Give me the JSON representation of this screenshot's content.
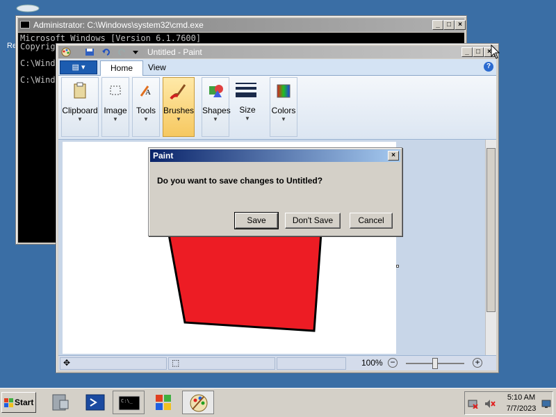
{
  "desktop": {
    "icon_label": "Re"
  },
  "cmd": {
    "title": "Administrator: C:\\Windows\\system32\\cmd.exe",
    "lines": [
      "Microsoft Windows [Version 6.1.7600]",
      "Copyrig",
      "",
      "C:\\Wind",
      "",
      "C:\\Wind"
    ]
  },
  "paint": {
    "title": "Untitled - Paint",
    "tabs": [
      "Home",
      "View"
    ],
    "groups": [
      "Clipboard",
      "Image",
      "Tools",
      "Brushes",
      "Shapes",
      "Size",
      "Colors"
    ],
    "zoom": "100%"
  },
  "dialog": {
    "title": "Paint",
    "message": "Do you want to save changes to Untitled?",
    "save": "Save",
    "dont_save": "Don't Save",
    "cancel": "Cancel"
  },
  "taskbar": {
    "start": "Start",
    "time": "5:10 AM",
    "date": "7/7/2023"
  },
  "colors": {
    "shape_fill": "#ed1c24",
    "desktop": "#3a6ea5"
  }
}
